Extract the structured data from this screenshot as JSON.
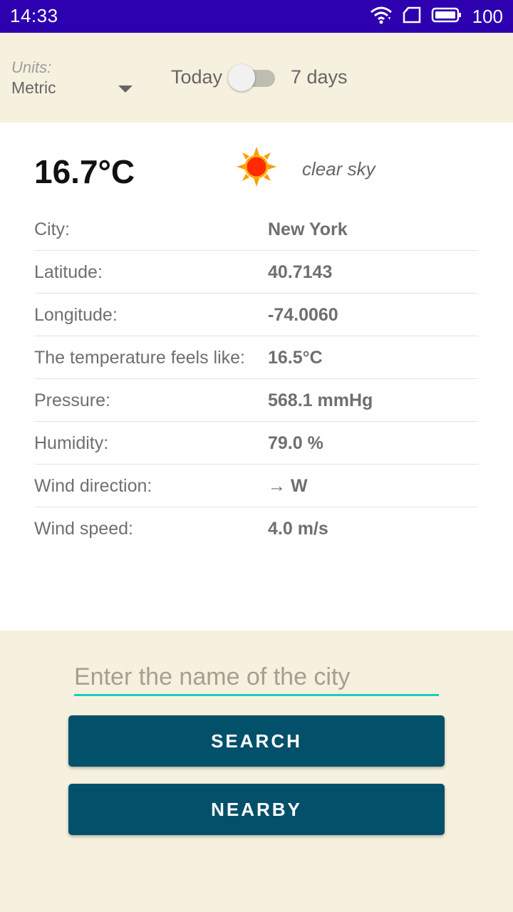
{
  "status_bar": {
    "time": "14:33",
    "battery": "100",
    "icons": [
      "wifi-icon",
      "sim-card-icon",
      "battery-icon"
    ]
  },
  "controls": {
    "units_label": "Units:",
    "units_value": "Metric",
    "toggle_left": "Today",
    "toggle_right": "7 days",
    "toggle_state": "off"
  },
  "weather": {
    "temperature": "16.7°C",
    "icon": "sun-icon",
    "description": "clear sky",
    "rows": [
      {
        "label": "City:",
        "value": "New York"
      },
      {
        "label": "Latitude:",
        "value": "40.7143"
      },
      {
        "label": "Longitude:",
        "value": "-74.0060"
      },
      {
        "label": "The temperature feels like:",
        "value": "16.5°C"
      },
      {
        "label": "Pressure:",
        "value": "568.1 mmHg"
      },
      {
        "label": "Humidity:",
        "value": "79.0 %"
      },
      {
        "label": "Wind direction:",
        "value": "→ W"
      },
      {
        "label": "Wind speed:",
        "value": "4.0 m/s"
      }
    ]
  },
  "search": {
    "placeholder": "Enter the name of the city",
    "value": "",
    "search_label": "SEARCH",
    "nearby_label": "NEARBY"
  },
  "colors": {
    "status_bar": "#2d00b0",
    "background": "#f6f0de",
    "button": "#02506a",
    "input_underline": "#1ccbc0"
  }
}
